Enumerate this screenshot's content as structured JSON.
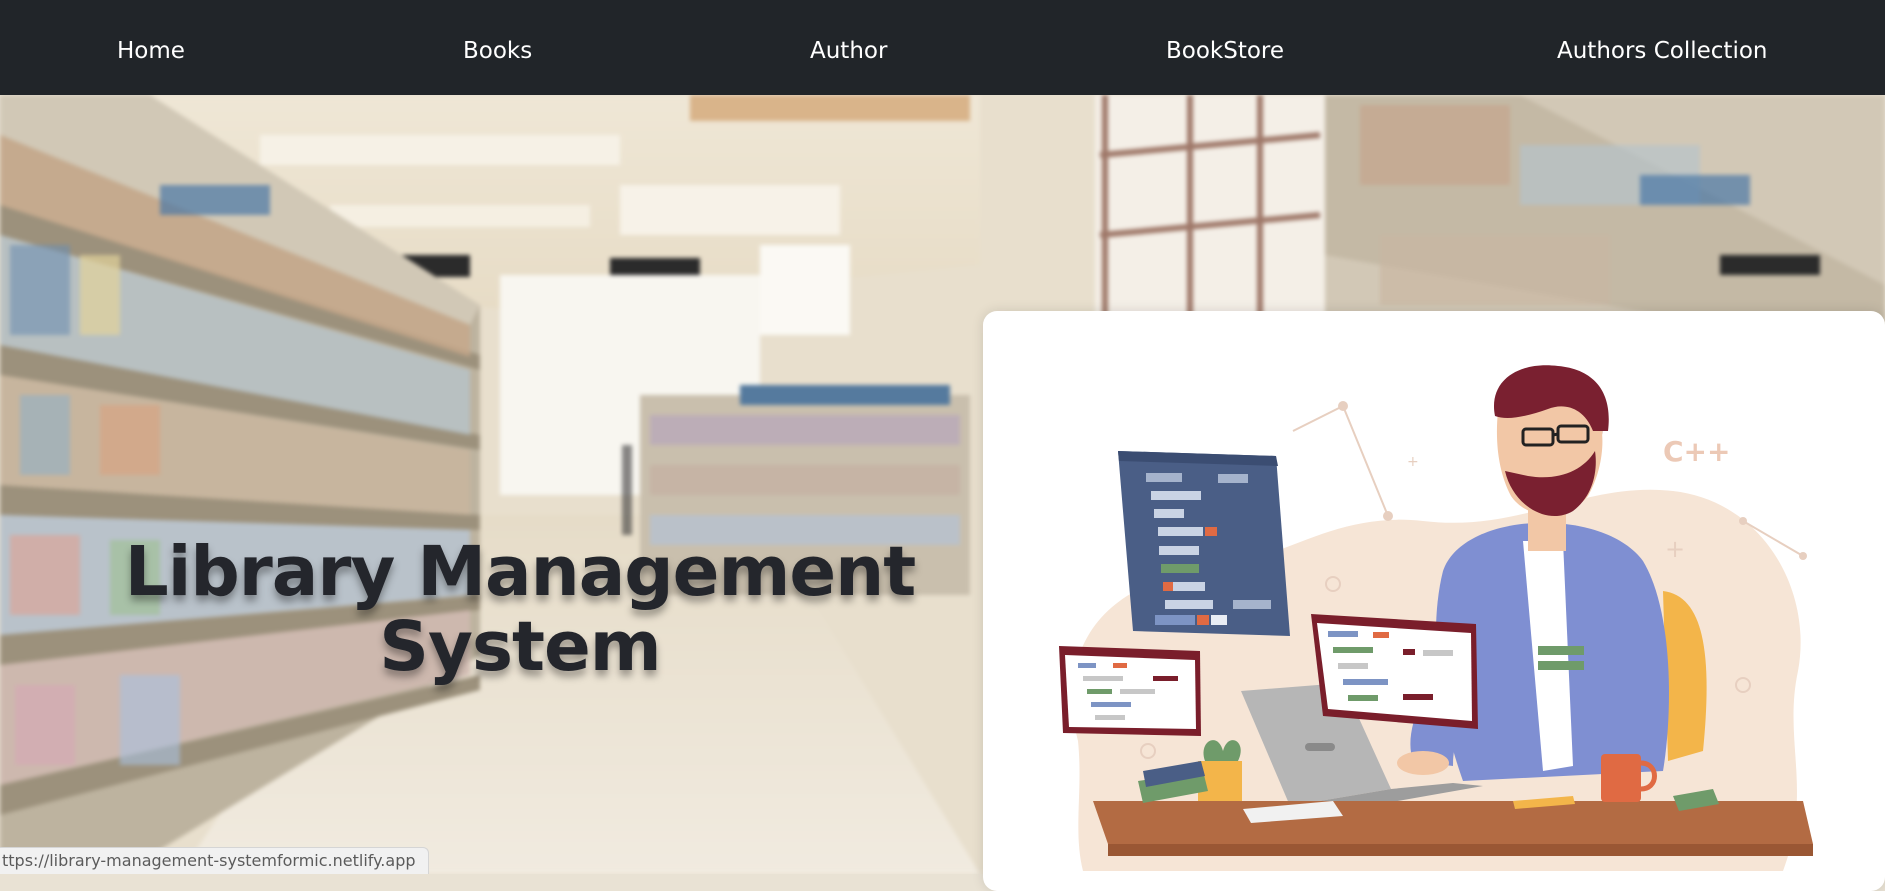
{
  "nav": {
    "items": [
      {
        "label": "Home"
      },
      {
        "label": "Books"
      },
      {
        "label": "Author"
      },
      {
        "label": "BookStore"
      },
      {
        "label": "Authors Collection"
      }
    ]
  },
  "hero": {
    "title_line1": "Library Management",
    "title_line2": "System",
    "illustration_text": "C++"
  },
  "status_bar": {
    "url": "ttps://library-management-systemformic.netlify.app"
  },
  "colors": {
    "navbar_bg": "#212529",
    "nav_text": "#ffffff",
    "title_text": "#24262c",
    "card_bg": "#ffffff"
  }
}
